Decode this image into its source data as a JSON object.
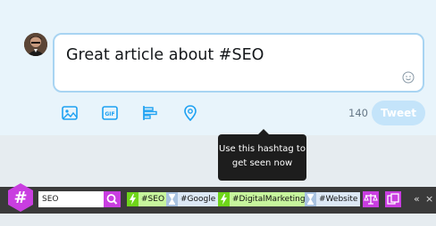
{
  "compose": {
    "text": "Great article about #SEO",
    "char_count": "140",
    "tweet_label": "Tweet",
    "tools": [
      "image-icon",
      "gif-icon",
      "poll-icon",
      "location-icon"
    ]
  },
  "tooltip": {
    "text": "Use this hashtag to\nget seen now"
  },
  "hashtag_bar": {
    "logo": "#",
    "search_value": "SEO",
    "tags": [
      {
        "label": "#SEO",
        "status": "hot"
      },
      {
        "label": "#Google",
        "status": "medium"
      },
      {
        "label": "#DigitalMarketing",
        "status": "hot"
      },
      {
        "label": "#Website",
        "status": "medium"
      }
    ]
  },
  "colors": {
    "accent": "#c93ee0",
    "hot": "#6fd51a",
    "medium": "#a8c2e0",
    "tweet_button": "#c4e4fa"
  }
}
